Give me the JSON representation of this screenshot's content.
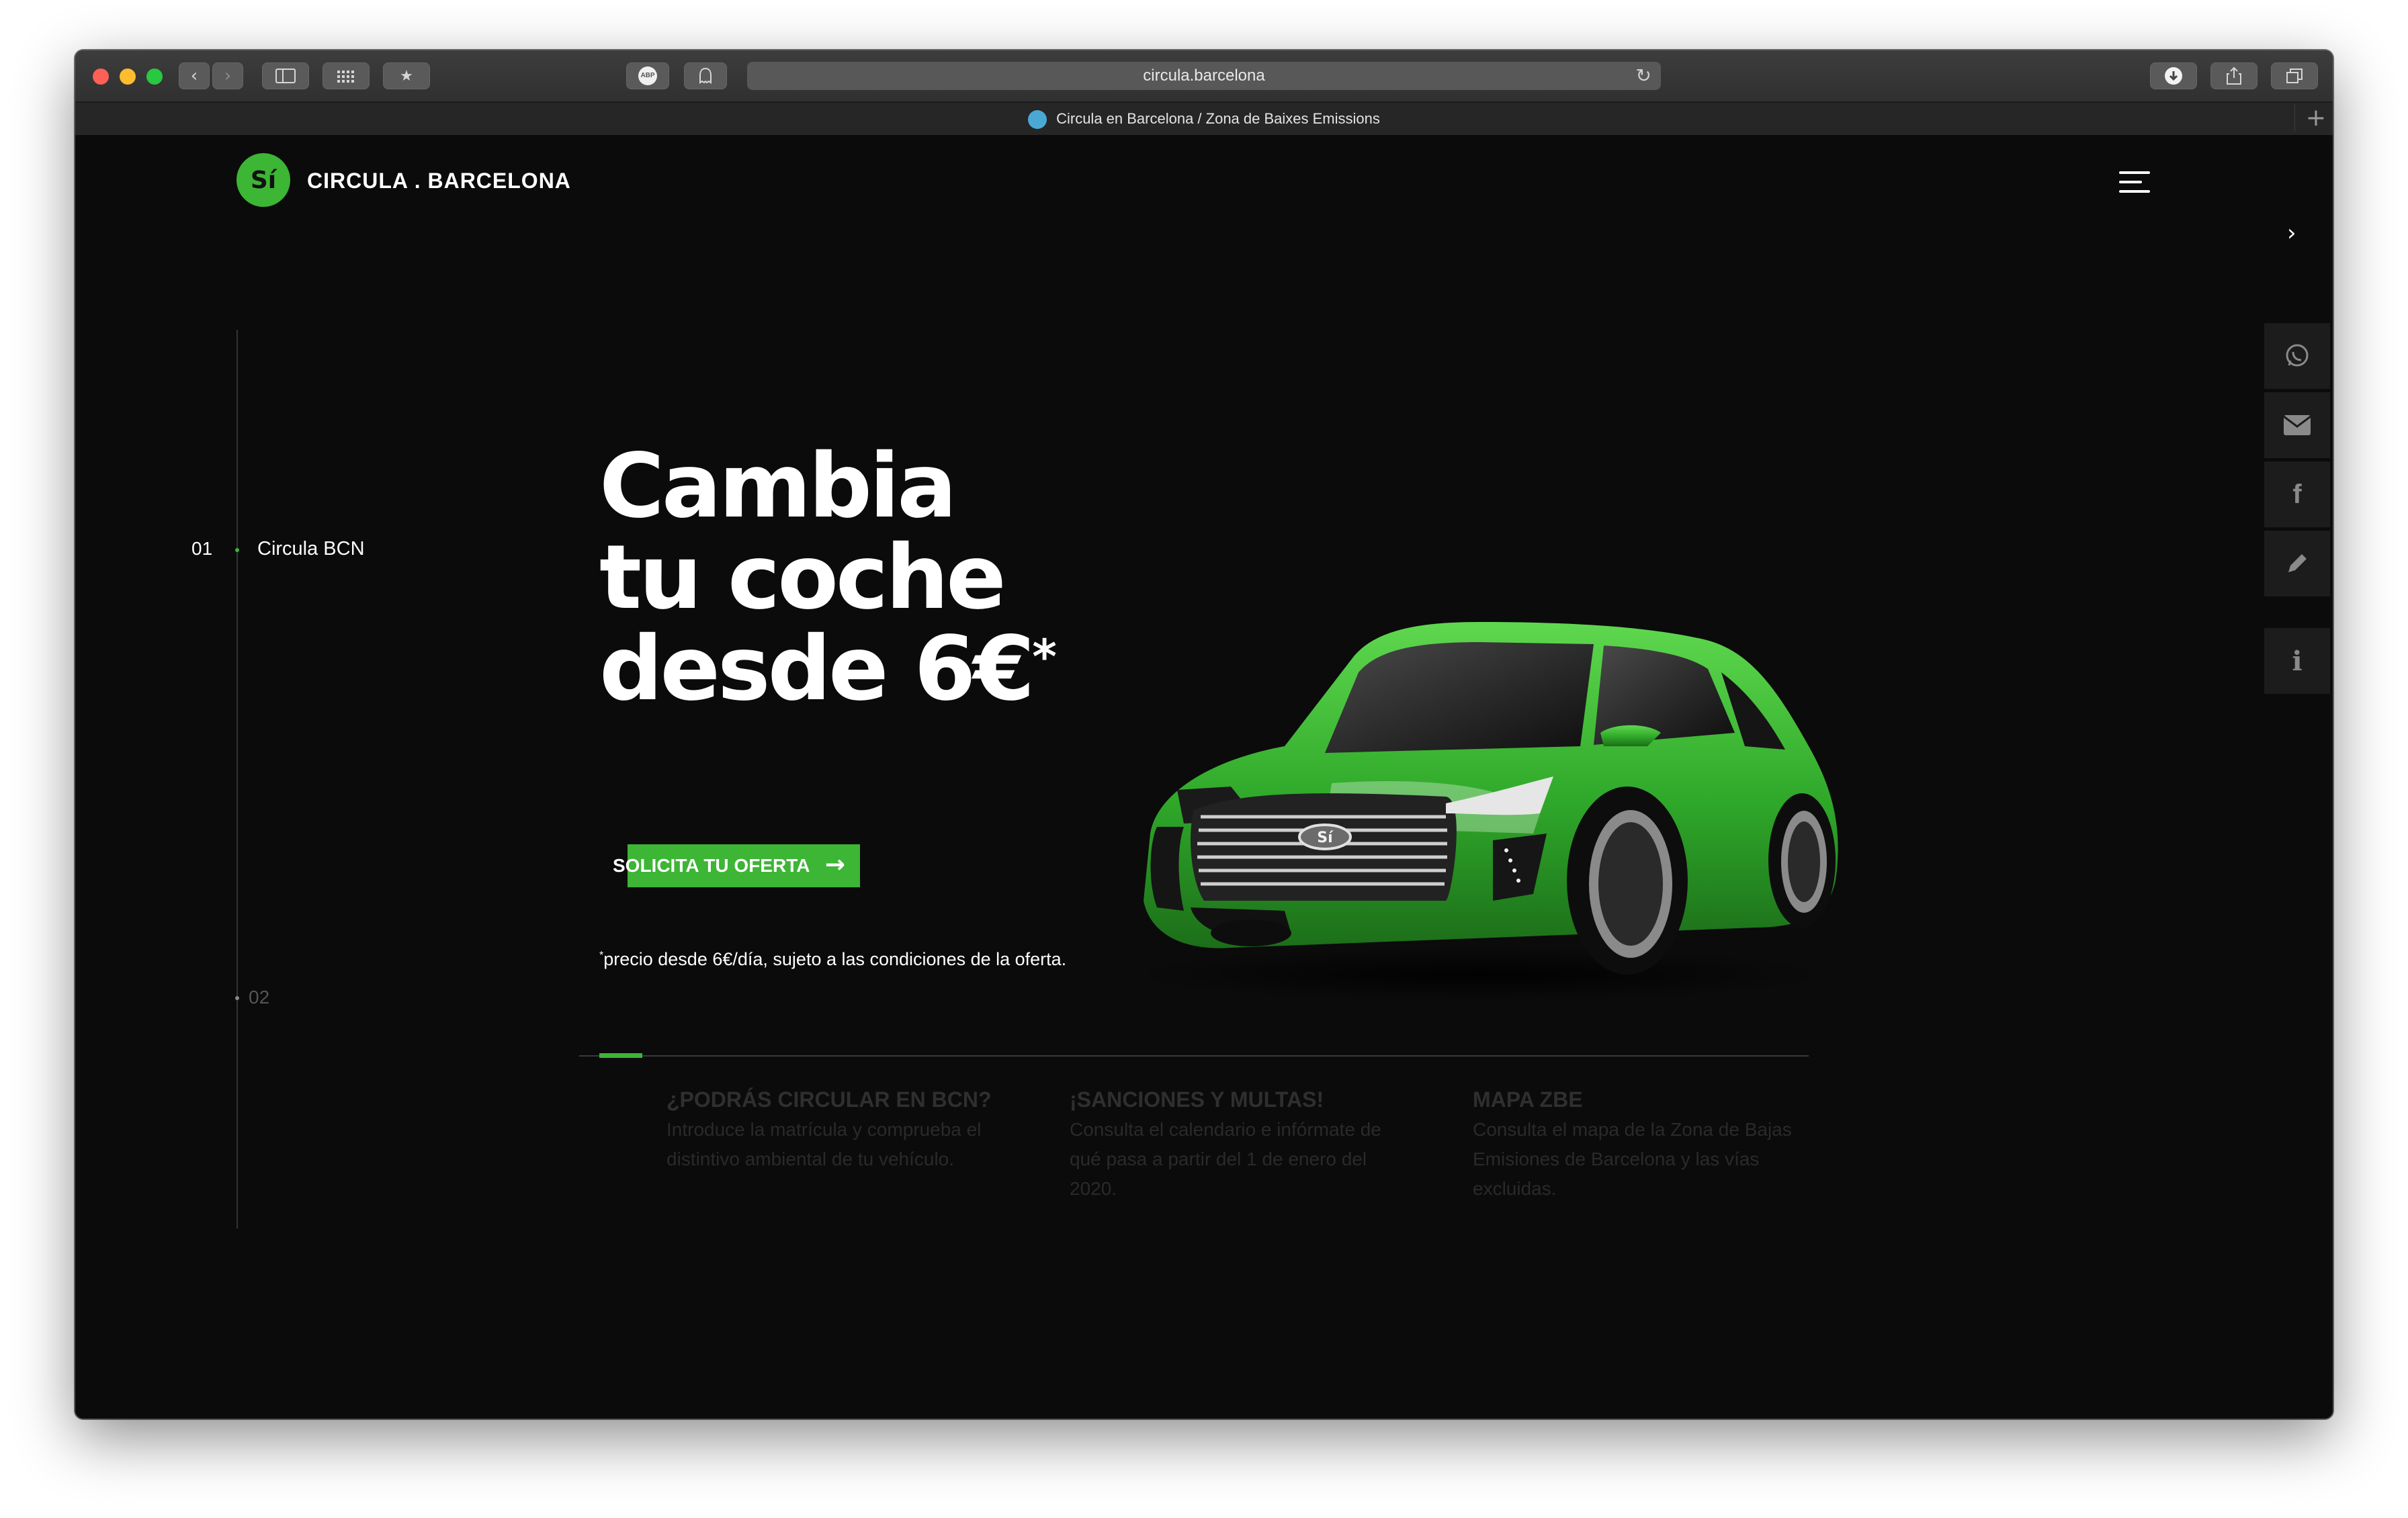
{
  "browser": {
    "url": "circula.barcelona",
    "tab_title": "Circula en Barcelona / Zona de Baixes Emissions",
    "icons": [
      "back-icon",
      "forward-icon",
      "sidebar-icon",
      "grid-icon",
      "bookmark-star-icon",
      "adblock-icon",
      "ghostery-icon",
      "reload-icon",
      "download-icon",
      "share-icon",
      "tabs-icon",
      "new-tab-icon"
    ],
    "adblock_label": "ABP"
  },
  "header": {
    "logo_mark": "Sí",
    "logo_text": "CIRCULA . BARCELONA"
  },
  "section_nav": [
    {
      "number": "01",
      "label": "Circula BCN",
      "active": true
    },
    {
      "number": "02",
      "label": "",
      "active": false
    }
  ],
  "hero": {
    "headline_lines": [
      "Cambia",
      "tu coche",
      "desde 6€"
    ],
    "asterisk": "*",
    "cta_label": "SOLICITA TU OFERTA",
    "note_mark": "*",
    "note": "precio desde 6€/día, sujeto a las condiciones de la oferta.",
    "car_plate": "Sí"
  },
  "slider_progress": 0.035,
  "features": [
    {
      "title": "¿PODRÁS CIRCULAR EN BCN?",
      "body": "Introduce la matrícula y comprueba el distintivo ambiental de tu vehículo."
    },
    {
      "title": "¡SANCIONES Y MULTAS!",
      "body": "Consulta el calendario e infórmate de qué pasa a partir del 1 de enero del 2020."
    },
    {
      "title": "MAPA ZBE",
      "body": "Consulta el mapa de la Zona de Bajas Emisiones de Barcelona y las vías excluidas."
    }
  ],
  "side_actions": [
    "whatsapp-icon",
    "mail-icon",
    "facebook-icon",
    "edit-icon",
    "info-icon"
  ],
  "colors": {
    "accent": "#3db535",
    "background": "#0b0b0b",
    "muted_text": "#2c2c2c"
  }
}
